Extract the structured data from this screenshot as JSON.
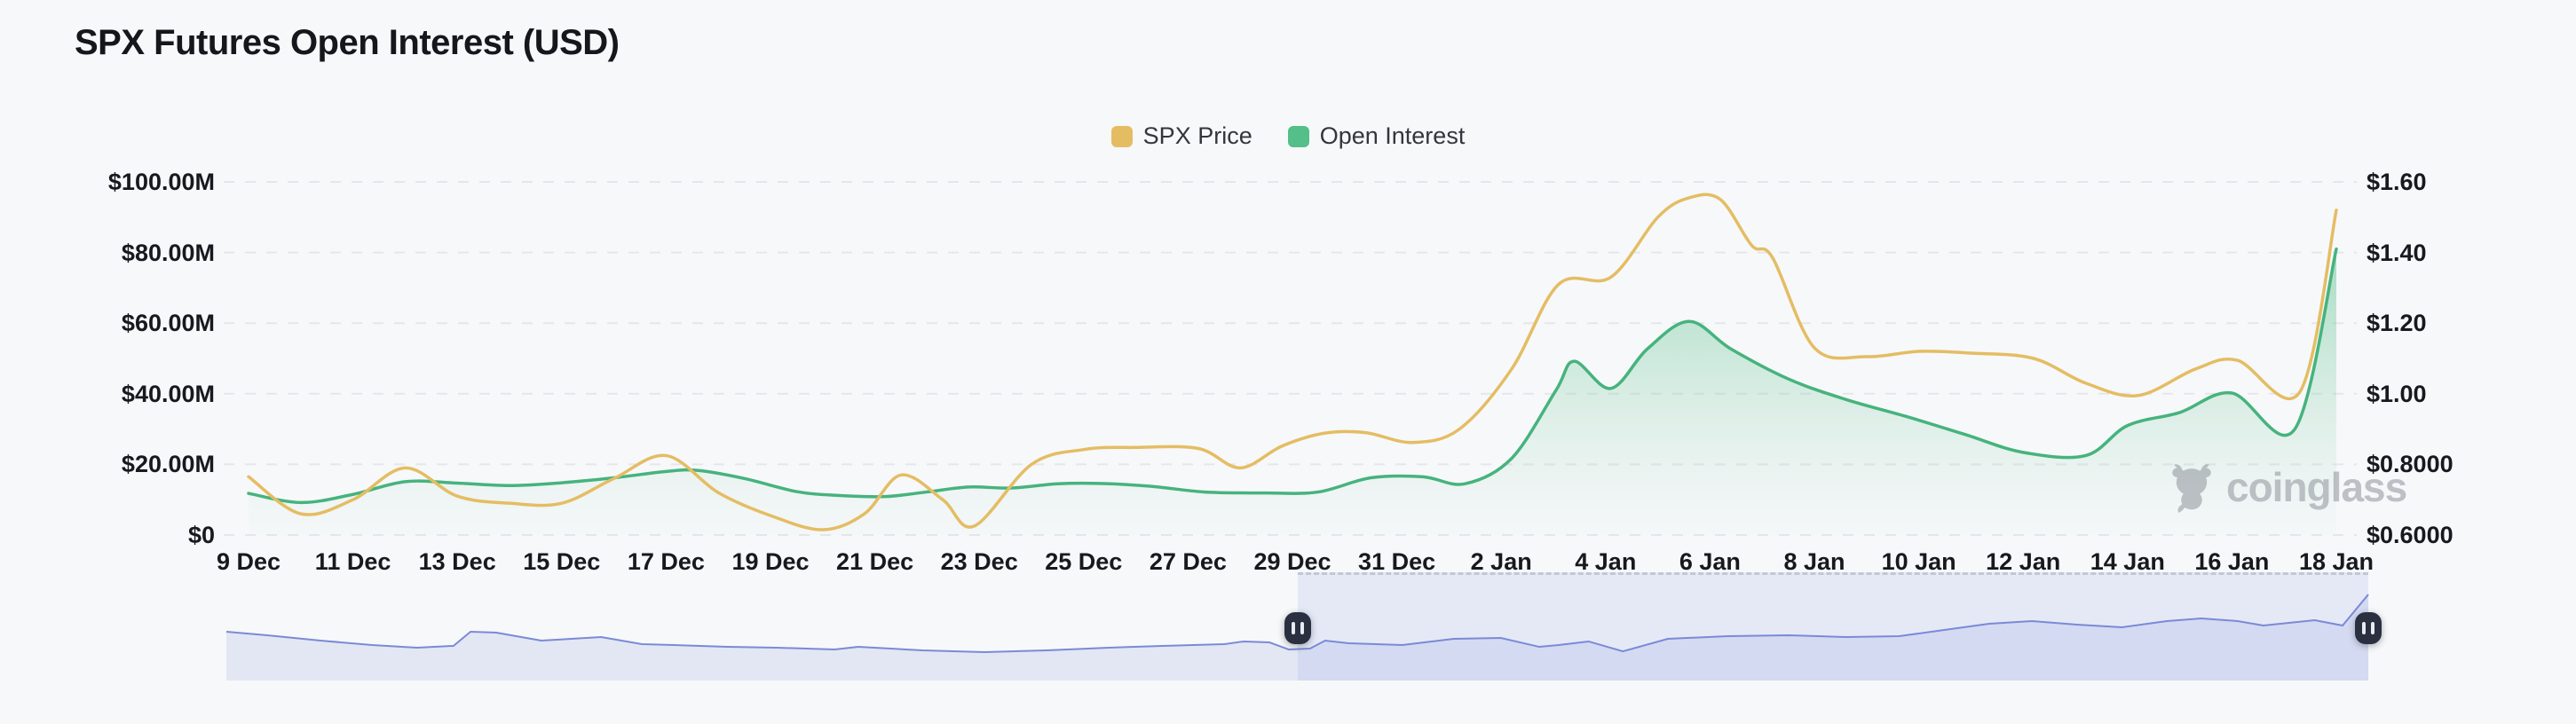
{
  "header": {
    "title": "SPX Futures Open Interest (USD)"
  },
  "legend": {
    "items": [
      {
        "label": "SPX Price",
        "color": "#e4bd63"
      },
      {
        "label": "Open Interest",
        "color": "#54bf88"
      }
    ]
  },
  "watermark": {
    "text": "coinglass",
    "icon": "coinglass-bull-icon",
    "color": "#8f949c"
  },
  "chart_data": {
    "type": "line",
    "title": "SPX Futures Open Interest (USD)",
    "grid": "horizontal dashed",
    "legend_position": "top center",
    "x_unit": "days since 9 Dec",
    "x_range": [
      0,
      40
    ],
    "x_tick_labels": [
      "9 Dec",
      "11 Dec",
      "13 Dec",
      "15 Dec",
      "17 Dec",
      "19 Dec",
      "21 Dec",
      "23 Dec",
      "25 Dec",
      "27 Dec",
      "29 Dec",
      "31 Dec",
      "2 Jan",
      "4 Jan",
      "6 Jan",
      "8 Jan",
      "10 Jan",
      "12 Jan",
      "14 Jan",
      "16 Jan",
      "18 Jan"
    ],
    "left_axis": {
      "min": 0,
      "max": 100,
      "unit": "USD millions",
      "tick_labels": [
        "$100.00M",
        "$80.00M",
        "$60.00M",
        "$40.00M",
        "$20.00M",
        "$0"
      ]
    },
    "right_axis": {
      "min": 0.6,
      "max": 1.6,
      "unit": "USD",
      "tick_labels": [
        "$1.60",
        "$1.40",
        "$1.20",
        "$1.00",
        "$0.8000",
        "$0.6000"
      ]
    },
    "series": [
      {
        "name": "SPX Price",
        "type": "line",
        "axis": "right",
        "color": "#e4bd63",
        "points": [
          [
            0,
            0.765
          ],
          [
            1,
            0.66
          ],
          [
            2,
            0.7
          ],
          [
            3,
            0.79
          ],
          [
            4,
            0.71
          ],
          [
            5,
            0.69
          ],
          [
            6,
            0.69
          ],
          [
            7,
            0.76
          ],
          [
            8,
            0.825
          ],
          [
            9,
            0.72
          ],
          [
            10,
            0.655
          ],
          [
            11,
            0.615
          ],
          [
            11.8,
            0.66
          ],
          [
            12.5,
            0.77
          ],
          [
            13.3,
            0.7
          ],
          [
            13.9,
            0.625
          ],
          [
            15,
            0.8
          ],
          [
            16,
            0.842
          ],
          [
            17,
            0.848
          ],
          [
            18.2,
            0.845
          ],
          [
            19,
            0.79
          ],
          [
            19.8,
            0.852
          ],
          [
            20.6,
            0.888
          ],
          [
            21.4,
            0.89
          ],
          [
            22.3,
            0.862
          ],
          [
            23.2,
            0.9
          ],
          [
            24.2,
            1.07
          ],
          [
            25.1,
            1.31
          ],
          [
            26.1,
            1.33
          ],
          [
            27,
            1.5
          ],
          [
            27.6,
            1.555
          ],
          [
            28.2,
            1.55
          ],
          [
            28.8,
            1.42
          ],
          [
            29.2,
            1.385
          ],
          [
            30,
            1.13
          ],
          [
            31,
            1.105
          ],
          [
            32,
            1.12
          ],
          [
            33,
            1.115
          ],
          [
            34.2,
            1.1
          ],
          [
            35.2,
            1.03
          ],
          [
            36.2,
            0.995
          ],
          [
            37.3,
            1.07
          ],
          [
            38.1,
            1.095
          ],
          [
            39.3,
            1.005
          ],
          [
            40,
            1.52
          ]
        ]
      },
      {
        "name": "Open Interest",
        "type": "area",
        "axis": "left",
        "color": "#46b37d",
        "fill_gradient_top": "rgba(84,190,136,0.50)",
        "fill_gradient_bottom": "rgba(170,220,195,0.03)",
        "points": [
          [
            0,
            11.8
          ],
          [
            1,
            9.2
          ],
          [
            2,
            11.5
          ],
          [
            3,
            15.1
          ],
          [
            4,
            14.7
          ],
          [
            5,
            14.0
          ],
          [
            6,
            14.8
          ],
          [
            7,
            16.2
          ],
          [
            8,
            18.0
          ],
          [
            8.6,
            18.3
          ],
          [
            9.5,
            16.0
          ],
          [
            10.5,
            12.3
          ],
          [
            11.3,
            11.2
          ],
          [
            12.2,
            10.9
          ],
          [
            13.0,
            12.2
          ],
          [
            13.8,
            13.6
          ],
          [
            14.6,
            13.3
          ],
          [
            15.5,
            14.5
          ],
          [
            16.3,
            14.6
          ],
          [
            17.3,
            13.8
          ],
          [
            18.3,
            12.2
          ],
          [
            19.5,
            11.9
          ],
          [
            20.5,
            12.2
          ],
          [
            21.5,
            16.2
          ],
          [
            22.5,
            16.5
          ],
          [
            23.3,
            14.5
          ],
          [
            24.2,
            21.7
          ],
          [
            25.05,
            41
          ],
          [
            25.4,
            49.2
          ],
          [
            26.1,
            41.5
          ],
          [
            26.8,
            52.7
          ],
          [
            27.6,
            60.5
          ],
          [
            28.4,
            52.7
          ],
          [
            29.5,
            44.2
          ],
          [
            30.6,
            38.4
          ],
          [
            31.8,
            33.4
          ],
          [
            32.9,
            28.4
          ],
          [
            34,
            23.4
          ],
          [
            35.2,
            22.5
          ],
          [
            36,
            31
          ],
          [
            37,
            34.7
          ],
          [
            38,
            40.2
          ],
          [
            39.2,
            29.9
          ],
          [
            40,
            81
          ]
        ]
      }
    ]
  },
  "navigator": {
    "description": "data-zoom minimap brush",
    "line_color": "#7b8ad6",
    "fill_color": "rgba(124,140,218,0.16)",
    "selection_color": "rgba(122,140,228,0.14)",
    "selection": [
      0.5,
      1.0
    ],
    "handle_icon": "pause-bars",
    "sparkline": [
      [
        0,
        0.538
      ],
      [
        0.019,
        0.571
      ],
      [
        0.044,
        0.622
      ],
      [
        0.068,
        0.664
      ],
      [
        0.089,
        0.689
      ],
      [
        0.106,
        0.672
      ],
      [
        0.114,
        0.538
      ],
      [
        0.126,
        0.546
      ],
      [
        0.147,
        0.622
      ],
      [
        0.168,
        0.597
      ],
      [
        0.175,
        0.588
      ],
      [
        0.194,
        0.655
      ],
      [
        0.209,
        0.664
      ],
      [
        0.234,
        0.681
      ],
      [
        0.257,
        0.689
      ],
      [
        0.284,
        0.706
      ],
      [
        0.295,
        0.681
      ],
      [
        0.325,
        0.714
      ],
      [
        0.354,
        0.731
      ],
      [
        0.383,
        0.714
      ],
      [
        0.412,
        0.689
      ],
      [
        0.437,
        0.672
      ],
      [
        0.466,
        0.655
      ],
      [
        0.475,
        0.63
      ],
      [
        0.487,
        0.639
      ],
      [
        0.496,
        0.706
      ],
      [
        0.506,
        0.697
      ],
      [
        0.513,
        0.622
      ],
      [
        0.524,
        0.647
      ],
      [
        0.549,
        0.664
      ],
      [
        0.573,
        0.605
      ],
      [
        0.595,
        0.597
      ],
      [
        0.613,
        0.681
      ],
      [
        0.622,
        0.664
      ],
      [
        0.636,
        0.63
      ],
      [
        0.652,
        0.723
      ],
      [
        0.673,
        0.605
      ],
      [
        0.701,
        0.58
      ],
      [
        0.729,
        0.571
      ],
      [
        0.756,
        0.588
      ],
      [
        0.781,
        0.58
      ],
      [
        0.802,
        0.521
      ],
      [
        0.823,
        0.462
      ],
      [
        0.843,
        0.437
      ],
      [
        0.864,
        0.471
      ],
      [
        0.885,
        0.496
      ],
      [
        0.906,
        0.437
      ],
      [
        0.922,
        0.412
      ],
      [
        0.939,
        0.437
      ],
      [
        0.951,
        0.479
      ],
      [
        0.975,
        0.429
      ],
      [
        0.988,
        0.479
      ],
      [
        1,
        0.185
      ]
    ]
  }
}
